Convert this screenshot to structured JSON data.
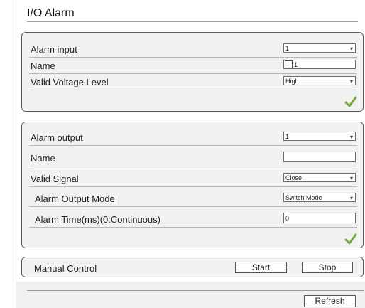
{
  "page": {
    "title": "I/O Alarm"
  },
  "alarm_input": {
    "rows": [
      {
        "label": "Alarm input",
        "value": "1",
        "control": "select"
      },
      {
        "label": "Name",
        "value": "1",
        "control": "checkbox-text"
      },
      {
        "label": "Valid Voltage Level",
        "value": "High",
        "control": "select"
      }
    ],
    "save_icon": "checkmark-icon"
  },
  "alarm_output": {
    "rows": [
      {
        "label": "Alarm output",
        "value": "1",
        "control": "select"
      },
      {
        "label": "Name",
        "value": "",
        "control": "text"
      },
      {
        "label": "Valid Signal",
        "value": "Close",
        "control": "select"
      },
      {
        "label": "Alarm Output Mode",
        "value": "Switch Mode",
        "control": "select"
      },
      {
        "label": "Alarm Time(ms)(0:Continuous)",
        "value": "0",
        "control": "text"
      }
    ],
    "save_icon": "checkmark-icon"
  },
  "manual_control": {
    "label": "Manual Control",
    "start_label": "Start",
    "stop_label": "Stop"
  },
  "footer": {
    "refresh_label": "Refresh"
  },
  "colors": {
    "panel_bg": "#f1f1f1",
    "panel_border": "#5b5b5b",
    "check_green": "#7aa83a"
  }
}
